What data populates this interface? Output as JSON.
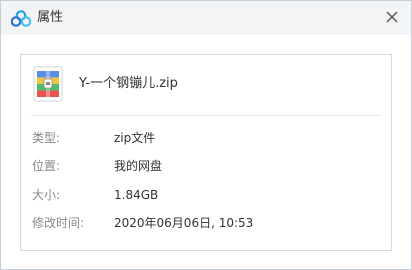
{
  "window": {
    "title": "属性",
    "icon": "cloud-icon",
    "close_icon": "close-icon"
  },
  "file": {
    "name": "Y-一个钢镚儿.zip",
    "icon": "zip-archive-icon"
  },
  "properties": [
    {
      "label": "类型:",
      "value": "zip文件"
    },
    {
      "label": "位置:",
      "value": "我的网盘"
    },
    {
      "label": "大小:",
      "value": "1.84GB"
    },
    {
      "label": "修改时间:",
      "value": "2020年06月06日, 10:53"
    }
  ],
  "colors": {
    "titlebar_bg": "#f3f4f6",
    "border": "#d6d9de",
    "label_text": "#888888",
    "value_text": "#333333"
  }
}
